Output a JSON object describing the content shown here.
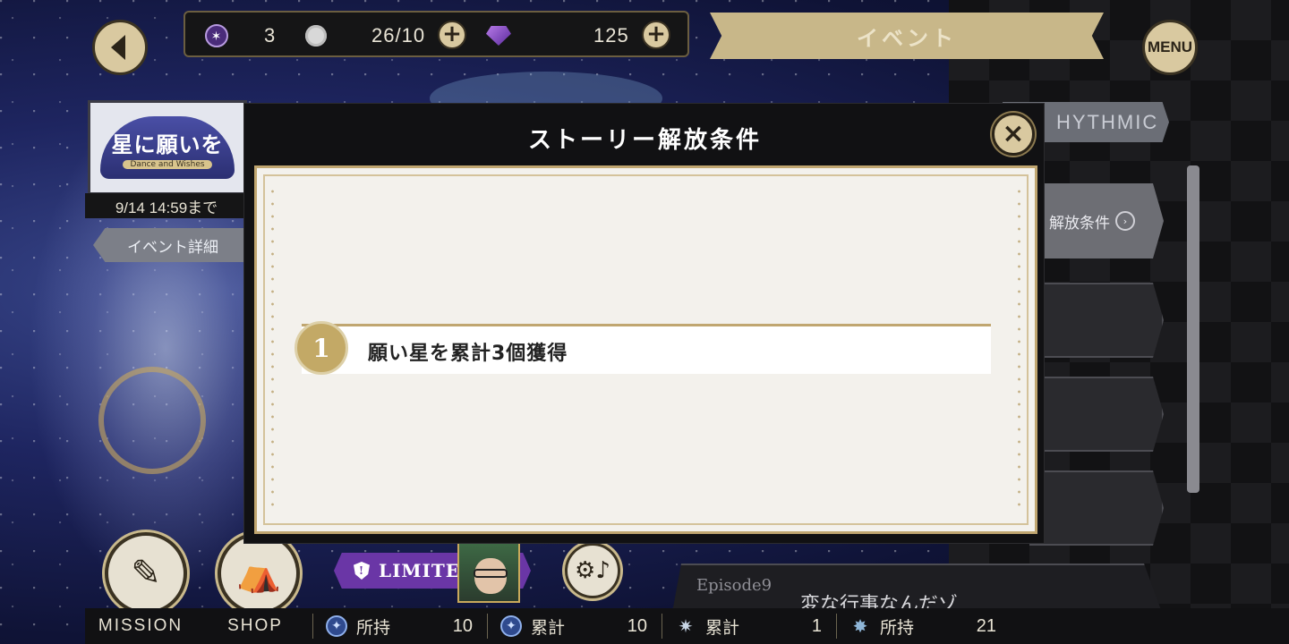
{
  "top_bar": {
    "resources": [
      {
        "icon": "star-orb-icon",
        "value": "3"
      },
      {
        "icon": "flower-icon",
        "value": "26/10"
      },
      {
        "icon": "gem-icon",
        "value": "125"
      }
    ],
    "event_banner": "イベント",
    "menu_label": "MENU"
  },
  "event_panel": {
    "logo_title": "星に願いを",
    "logo_subtitle": "Dance and Wishes",
    "date": "9/14 14:59まで",
    "detail_button": "イベント詳細"
  },
  "right_panel": {
    "rhythmic_tab": "HYTHMIC",
    "unlock_tab": "解放条件",
    "episode_tag": "Episode9",
    "episode_title": "変な行事なんだゾ"
  },
  "modal": {
    "title": "ストーリー解放条件",
    "conditions": [
      {
        "number": "1",
        "text": "願い星を累計3個獲得"
      }
    ]
  },
  "bottom": {
    "mission_label": "MISSION",
    "shop_label": "SHOP",
    "limited_label": "LIMITED",
    "stats": [
      {
        "icon": "blue-star-icon",
        "label": "所持",
        "value": "10"
      },
      {
        "icon": "blue-star-icon",
        "label": "累計",
        "value": "10"
      },
      {
        "icon": "sparkle-icon",
        "label": "累計",
        "value": "1"
      },
      {
        "icon": "star-shard-icon",
        "label": "所持",
        "value": "21"
      }
    ]
  }
}
